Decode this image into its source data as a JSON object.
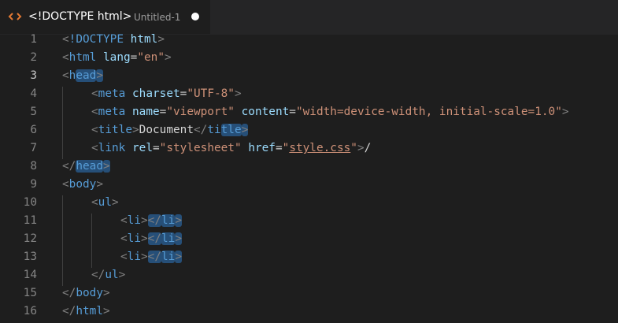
{
  "tab": {
    "title": "<!DOCTYPE html>",
    "description": "Untitled-1",
    "icon": "html-file-icon",
    "dirty": true
  },
  "editor": {
    "active_line": 3,
    "lines": [
      {
        "n": "1",
        "indent": 0,
        "tokens": [
          [
            "punc",
            "<"
          ],
          [
            "tag",
            "!DOCTYPE "
          ],
          [
            "attr",
            "html"
          ],
          [
            "punc",
            ">"
          ]
        ]
      },
      {
        "n": "2",
        "indent": 0,
        "tokens": [
          [
            "punc",
            "<"
          ],
          [
            "tag",
            "html "
          ],
          [
            "attr",
            "lang"
          ],
          [
            "text",
            "="
          ],
          [
            "str",
            "\"en\""
          ],
          [
            "punc",
            ">"
          ]
        ]
      },
      {
        "n": "3",
        "indent": 0,
        "tokens": [
          [
            "punc",
            "<"
          ],
          [
            "tag",
            "h"
          ],
          [
            "tag",
            "ead",
            "hl"
          ],
          [
            "punc",
            ">",
            "hl"
          ]
        ]
      },
      {
        "n": "4",
        "indent": 1,
        "tokens": [
          [
            "punc",
            "<"
          ],
          [
            "tag",
            "meta "
          ],
          [
            "attr",
            "charset"
          ],
          [
            "text",
            "="
          ],
          [
            "str",
            "\"UTF-8\""
          ],
          [
            "punc",
            ">"
          ]
        ]
      },
      {
        "n": "5",
        "indent": 1,
        "tokens": [
          [
            "punc",
            "<"
          ],
          [
            "tag",
            "meta "
          ],
          [
            "attr",
            "name"
          ],
          [
            "text",
            "="
          ],
          [
            "str",
            "\"viewport\" "
          ],
          [
            "attr",
            "content"
          ],
          [
            "text",
            "="
          ],
          [
            "str",
            "\"width=device-width, initial-scale=1.0\""
          ],
          [
            "punc",
            ">"
          ]
        ]
      },
      {
        "n": "6",
        "indent": 1,
        "tokens": [
          [
            "punc",
            "<"
          ],
          [
            "tag",
            "title"
          ],
          [
            "punc",
            ">"
          ],
          [
            "text",
            "Document"
          ],
          [
            "punc",
            "</"
          ],
          [
            "tag",
            "ti"
          ],
          [
            "tag",
            "tle",
            "hl"
          ],
          [
            "punc",
            ">",
            "hl"
          ]
        ]
      },
      {
        "n": "7",
        "indent": 1,
        "tokens": [
          [
            "punc",
            "<"
          ],
          [
            "tag",
            "link "
          ],
          [
            "attr",
            "rel"
          ],
          [
            "text",
            "="
          ],
          [
            "str",
            "\"stylesheet\" "
          ],
          [
            "attr",
            "href"
          ],
          [
            "text",
            "="
          ],
          [
            "str",
            "\""
          ],
          [
            "str",
            "style.css",
            "ul"
          ],
          [
            "str",
            "\""
          ],
          [
            "punc",
            ">"
          ],
          [
            "text",
            "/"
          ]
        ]
      },
      {
        "n": "8",
        "indent": 0,
        "tokens": [
          [
            "punc",
            "</"
          ],
          [
            "tag",
            "head",
            "hl"
          ],
          [
            "punc",
            ">",
            "hl"
          ]
        ]
      },
      {
        "n": "9",
        "indent": 0,
        "tokens": [
          [
            "punc",
            "<"
          ],
          [
            "tag",
            "body"
          ],
          [
            "punc",
            ">"
          ]
        ]
      },
      {
        "n": "10",
        "indent": 1,
        "tokens": [
          [
            "punc",
            "<"
          ],
          [
            "tag",
            "ul"
          ],
          [
            "punc",
            ">"
          ]
        ]
      },
      {
        "n": "11",
        "indent": 2,
        "tokens": [
          [
            "punc",
            "<"
          ],
          [
            "tag",
            "li"
          ],
          [
            "punc",
            ">"
          ],
          [
            "punc",
            "</",
            "hl"
          ],
          [
            "tag",
            "li",
            "hl"
          ],
          [
            "punc",
            ">",
            "hl"
          ]
        ]
      },
      {
        "n": "12",
        "indent": 2,
        "tokens": [
          [
            "punc",
            "<"
          ],
          [
            "tag",
            "li"
          ],
          [
            "punc",
            ">"
          ],
          [
            "punc",
            "</",
            "hl"
          ],
          [
            "tag",
            "li",
            "hl"
          ],
          [
            "punc",
            ">",
            "hl"
          ]
        ]
      },
      {
        "n": "13",
        "indent": 2,
        "tokens": [
          [
            "punc",
            "<"
          ],
          [
            "tag",
            "li"
          ],
          [
            "punc",
            ">"
          ],
          [
            "punc",
            "</",
            "hl"
          ],
          [
            "tag",
            "li",
            "hl"
          ],
          [
            "punc",
            ">",
            "hl"
          ]
        ]
      },
      {
        "n": "14",
        "indent": 1,
        "tokens": [
          [
            "punc",
            "</"
          ],
          [
            "tag",
            "ul"
          ],
          [
            "punc",
            ">"
          ]
        ]
      },
      {
        "n": "15",
        "indent": 0,
        "tokens": [
          [
            "punc",
            "</"
          ],
          [
            "tag",
            "body"
          ],
          [
            "punc",
            ">"
          ]
        ]
      },
      {
        "n": "16",
        "indent": 0,
        "tokens": [
          [
            "punc",
            "</"
          ],
          [
            "tag",
            "html"
          ],
          [
            "punc",
            ">"
          ]
        ]
      }
    ]
  }
}
